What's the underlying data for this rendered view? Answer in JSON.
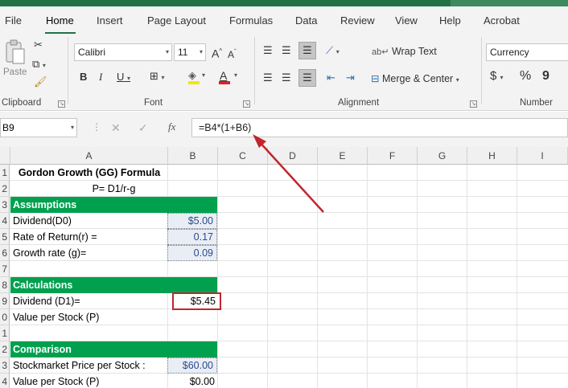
{
  "tabs": [
    "File",
    "Home",
    "Insert",
    "Page Layout",
    "Formulas",
    "Data",
    "Review",
    "View",
    "Help",
    "Acrobat"
  ],
  "ribbon": {
    "clipboard": {
      "paste_label": "Paste",
      "group_label": "Clipboard"
    },
    "font": {
      "name": "Calibri",
      "size": "11",
      "bold": "B",
      "italic": "I",
      "underline": "U",
      "group_label": "Font",
      "grow": "A",
      "shrink": "A"
    },
    "alignment": {
      "wrap_text": "Wrap Text",
      "merge_center": "Merge & Center",
      "group_label": "Alignment"
    },
    "number": {
      "format": "Currency",
      "currency_symbol": "$",
      "percent": "%",
      "comma": "9",
      "group_label": "Number"
    }
  },
  "formula_bar": {
    "name_box": "B9",
    "fx": "fx",
    "formula": "=B4*(1+B6)"
  },
  "columns": [
    "A",
    "B",
    "C",
    "D",
    "E",
    "F",
    "G",
    "H",
    "I"
  ],
  "rows": [
    "1",
    "2",
    "3",
    "4",
    "5",
    "6",
    "7",
    "8",
    "9",
    "0",
    "1",
    "2",
    "3",
    "4"
  ],
  "sheet": {
    "title": "Gordon Growth (GG) Formula",
    "formula_text": "P= D1/r-g",
    "assumptions_header": "Assumptions",
    "dividend_label": "Dividend(D0)",
    "dividend_value": "$5.00",
    "return_label": "Rate of Return(r) =",
    "return_value": "0.17",
    "growth_label": "Growth rate (g)=",
    "growth_value": "0.09",
    "calculations_header": "Calculations",
    "d1_label": "Dividend (D1)=",
    "d1_value": "$5.45",
    "vps_label": "Value per Stock (P)",
    "comparison_header": "Comparison",
    "market_label": "Stockmarket Price per Stock :",
    "market_value": "$60.00",
    "vps2_label": "Value per Stock (P)",
    "vps2_value": "$0.00"
  },
  "colors": {
    "accent": "#217346",
    "section_green": "#00a04f",
    "highlight_red": "#c0262d"
  }
}
